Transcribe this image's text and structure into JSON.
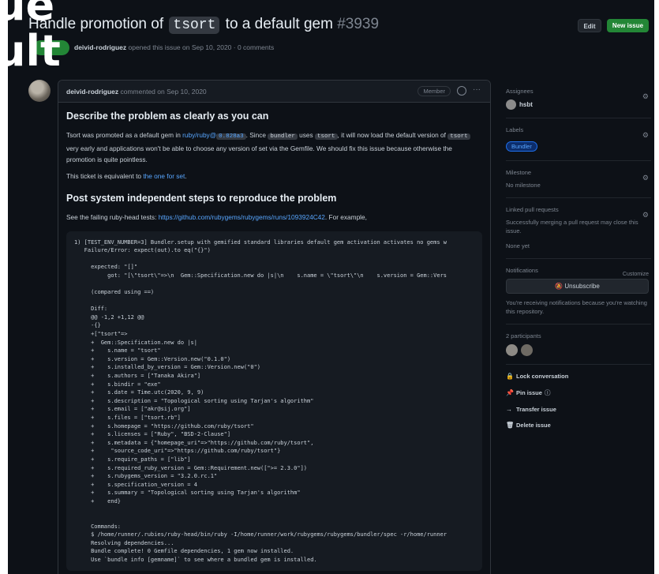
{
  "overlay": {
    "text": "ue\nult"
  },
  "header": {
    "title_before": "Handle promotion of ",
    "title_code": "tsort",
    "title_after": " to a default gem ",
    "issue_number": "#3939",
    "edit_label": "Edit",
    "new_issue_label": "New issue",
    "author": "deivid-rodriguez",
    "meta_text": " opened this issue on Sep 10, 2020 · 0 comments",
    "state_color": "#238636"
  },
  "comment": {
    "author": "deivid-rodriguez",
    "commented_text": " commented on Sep 10, 2020",
    "role_badge": "Member",
    "heading1": "Describe the problem as clearly as you can",
    "p1_a": "Tsort was promoted as a default gem in ",
    "p1_link": "ruby/ruby@",
    "p1_sha": "0.828a3",
    "p1_b": ". Since ",
    "p1_code1": "bundler",
    "p1_c": " uses ",
    "p1_code2": "tsort",
    "p1_d": ", it will now load the default version of ",
    "p1_code3": "tsort",
    "p1_e": " very early and applications won't be able to choose any version of set via the Gemfile. We should fix this issue because otherwise the promotion is quite pointless.",
    "p2_a": "This ticket is equivalent to ",
    "p2_link": "the one for set",
    "p2_b": ".",
    "heading2": "Post system independent steps to reproduce the problem",
    "p3_a": "See the failing ruby-head tests: ",
    "p3_link": "https://github.com/rubygems/rubygems/runs/1093924C42",
    "p3_b": ". For example,",
    "code_lines": [
      "1) [TEST_ENV_NUMBER=3] Bundler.setup with gemified standard libraries default gem activation activates no gems w",
      "   Failure/Error: expect(out).to eq(\"{}\")",
      "",
      "     expected: \"[]\"",
      "          got: \"[\\\"tsort\\\"=>\\n  Gem::Specification.new do |s|\\n    s.name = \\\"tsort\\\"\\n    s.version = Gem::Vers",
      "",
      "     (compared using ==)",
      "",
      "     Diff:",
      "     @@ -1,2 +1,12 @@",
      "     -{}",
      "     +[\"tsort\"=>",
      "     +  Gem::Specification.new do |s|",
      "     +    s.name = \"tsort\"",
      "     +    s.version = Gem::Version.new(\"0.1.0\")",
      "     +    s.installed_by_version = Gem::Version.new(\"0\")",
      "     +    s.authors = [\"Tanaka Akira\"]",
      "     +    s.bindir = \"exe\"",
      "     +    s.date = Time.utc(2020, 9, 9)",
      "     +    s.description = \"Topological sorting using Tarjan's algorithm\"",
      "     +    s.email = [\"akr@sij.org\"]",
      "     +    s.files = [\"tsort.rb\"]",
      "     +    s.homepage = \"https://github.com/ruby/tsort\"",
      "     +    s.licenses = [\"Ruby\", \"BSD-2-Clause\"]",
      "     +    s.metadata = {\"homepage_uri\"=>\"https://github.com/ruby/tsort\",",
      "     +     \"source_code_uri\"=>\"https://github.com/ruby/tsort\"}",
      "     +    s.require_paths = [\"lib\"]",
      "     +    s.required_ruby_version = Gem::Requirement.new([\">= 2.3.0\"])",
      "     +    s.rubygems_version = \"3.2.0.rc.1\"",
      "     +    s.specification_version = 4",
      "     +    s.summary = \"Topological sorting using Tarjan's algorithm\"",
      "     +    end}",
      "",
      "",
      "     Commands:",
      "     $ /home/runner/.rubies/ruby-head/bin/ruby -I/home/runner/work/rubygems/rubygems/bundler/spec -r/home/runner",
      "     Resolving dependencies...",
      "     Bundle complete! 0 Gemfile dependencies, 1 gem now installed.",
      "     Use `bundle info [gemname]` to see where a bundled gem is installed."
    ]
  },
  "sidebar": {
    "assignees_title": "Assignees",
    "assignee": "hsbt",
    "labels_title": "Labels",
    "label": "Bundler",
    "milestone_title": "Milestone",
    "milestone_value": "No milestone",
    "linked_title": "Linked pull requests",
    "linked_desc": "Successfully merging a pull request may close this issue.",
    "linked_value": "None yet",
    "notifications_title": "Notifications",
    "customize": "Customize",
    "unsubscribe": "Unsubscribe",
    "notif_desc": "You're receiving notifications because you're watching this repository.",
    "participants_title": "2 participants",
    "lock": "Lock conversation",
    "pin": "Pin issue",
    "transfer": "Transfer issue",
    "delete": "Delete issue"
  }
}
